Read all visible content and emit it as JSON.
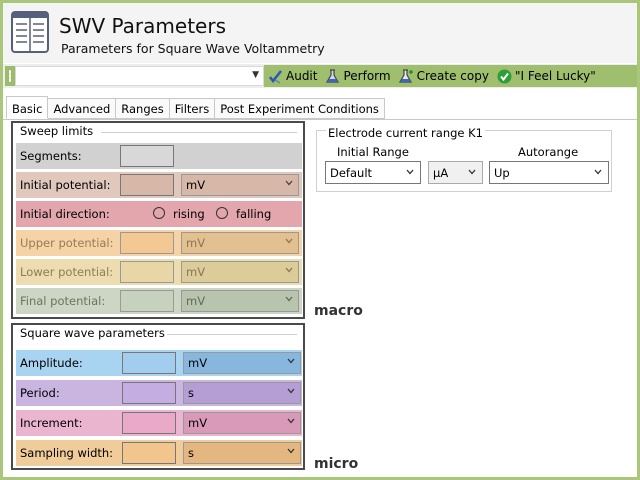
{
  "header": {
    "title": "SWV Parameters",
    "subtitle": "Parameters for Square Wave Voltammetry",
    "icon": "document-icon"
  },
  "toolbar": {
    "combo_value": "",
    "actions": [
      {
        "label": "Audit",
        "icon": "audit-check-icon"
      },
      {
        "label": "Perform",
        "icon": "perform-flask-icon"
      },
      {
        "label": "Create copy",
        "icon": "copy-flask-icon"
      },
      {
        "label": "\"I Feel Lucky\"",
        "icon": "green-check-icon"
      }
    ]
  },
  "tabs": [
    {
      "label": "Basic",
      "active": true
    },
    {
      "label": "Advanced",
      "active": false
    },
    {
      "label": "Ranges",
      "active": false
    },
    {
      "label": "Filters",
      "active": false
    },
    {
      "label": "Post Experiment Conditions",
      "active": false
    }
  ],
  "sweep": {
    "title": "Sweep limits",
    "tag": "macro",
    "segments": {
      "label": "Segments:",
      "value": ""
    },
    "initial_potential": {
      "label": "Initial potential:",
      "value": "",
      "unit": "mV"
    },
    "initial_direction": {
      "label": "Initial direction:",
      "opt1": "rising",
      "opt2": "falling"
    },
    "upper_potential": {
      "label": "Upper potential:",
      "value": "",
      "unit": "mV"
    },
    "lower_potential": {
      "label": "Lower potential:",
      "value": "",
      "unit": "mV"
    },
    "final_potential": {
      "label": "Final potential:",
      "value": "",
      "unit": "mV"
    }
  },
  "square": {
    "title": "Square wave parameters",
    "tag": "micro",
    "amplitude": {
      "label": "Amplitude:",
      "value": "",
      "unit": "mV"
    },
    "period": {
      "label": "Period:",
      "value": "",
      "unit": "s"
    },
    "increment": {
      "label": "Increment:",
      "value": "",
      "unit": "mV"
    },
    "sampling_width": {
      "label": "Sampling width:",
      "value": "",
      "unit": "s"
    }
  },
  "electrode": {
    "title": "Electrode current range K1",
    "initial_range_label": "Initial Range",
    "initial_range_value": "Default",
    "unit_value": "µA",
    "autorange_label": "Autorange",
    "autorange_value": "Up"
  },
  "colors": {
    "toolbar_green": "#9fbf6f",
    "segments_bg": "#d1d1d1",
    "initial_bg": "#e0c8bc",
    "direction_bg": "#e3a6ad",
    "upper_bg": "#f5d3a6",
    "lower_bg": "#ecdcb0",
    "final_bg": "#cdd6c4",
    "amplitude_bg": "#a8d3f1",
    "period_bg": "#c9b5df",
    "increment_bg": "#eab5cf",
    "sampling_bg": "#f1cc9b"
  }
}
